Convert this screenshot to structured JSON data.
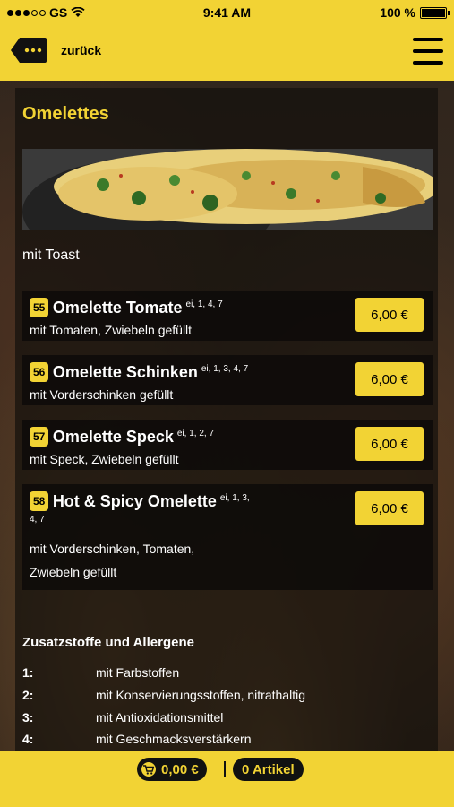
{
  "status": {
    "carrier": "GS",
    "time": "9:41 AM",
    "battery": "100 %"
  },
  "nav": {
    "back_label": "zurück"
  },
  "section": {
    "title": "Omelettes",
    "note": "mit Toast"
  },
  "items": [
    {
      "num": "55",
      "name": "Omelette Tomate",
      "allergens": "ei, 1, 4, 7",
      "desc": "mit Tomaten, Zwiebeln gefüllt",
      "price": "6,00 €"
    },
    {
      "num": "56",
      "name": "Omelette Schinken",
      "allergens": "ei, 1, 3, 4, 7",
      "desc": "mit Vorderschinken gefüllt",
      "price": "6,00 €"
    },
    {
      "num": "57",
      "name": "Omelette Speck",
      "allergens": "ei, 1, 2, 7",
      "desc": "mit Speck, Zwiebeln gefüllt",
      "price": "6,00 €"
    },
    {
      "num": "58",
      "name": "Hot & Spicy Omelette",
      "allergens": "ei, 1, 3,",
      "allergens_cont": "4, 7",
      "desc": "mit Vorderschinken, Tomaten,",
      "desc2": "Zwiebeln gefüllt",
      "price": "6,00 €"
    }
  ],
  "allergens": {
    "title": "Zusatzstoffe und Allergene",
    "rows": [
      {
        "num": "1:",
        "text": "mit Farbstoffen"
      },
      {
        "num": "2:",
        "text": "mit Konservierungsstoffen, nitrathaltig"
      },
      {
        "num": "3:",
        "text": "mit Antioxidationsmittel"
      },
      {
        "num": "4:",
        "text": "mit Geschmacksverstärkern"
      }
    ]
  },
  "footer": {
    "total": "0,00 €",
    "count": "0 Artikel"
  },
  "colors": {
    "accent": "#f2d334",
    "dark": "#111111"
  }
}
